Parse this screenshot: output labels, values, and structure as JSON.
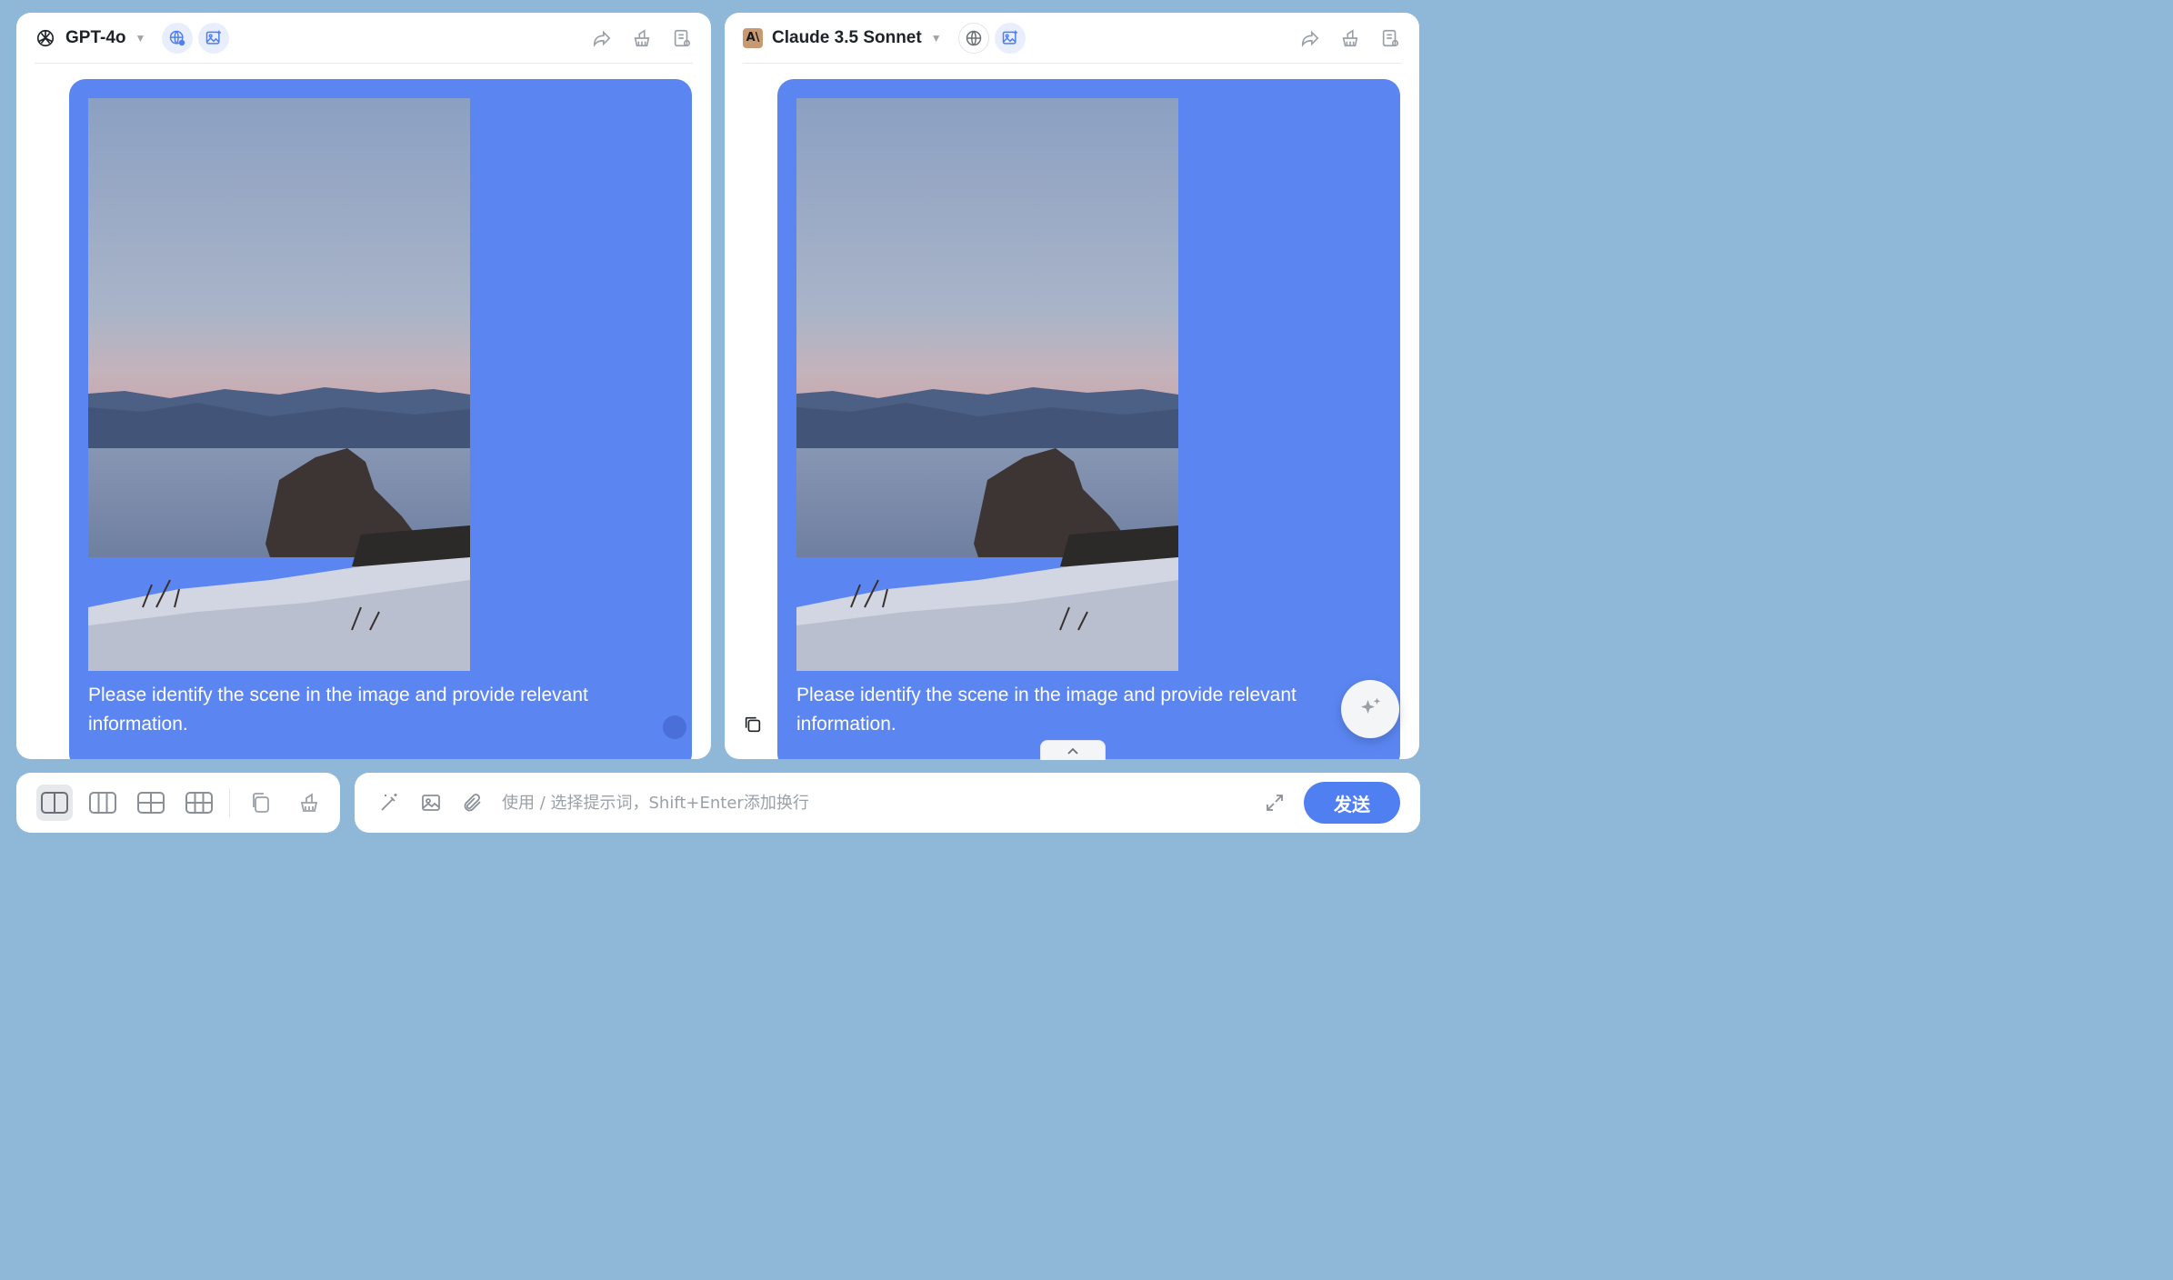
{
  "panels": [
    {
      "model_name": "GPT-4o",
      "model_logo": "openai-logo-icon",
      "web_search_active": true,
      "image_gen_active": true,
      "message": "Please identify the scene in the image and provide relevant information."
    },
    {
      "model_name": "Claude 3.5 Sonnet",
      "model_logo": "anthropic-logo-icon",
      "model_logo_text": "A\\",
      "web_search_active": false,
      "image_gen_active": true,
      "message": "Please identify the scene in the image and provide relevant information."
    }
  ],
  "input": {
    "placeholder": "使用 / 选择提示词，Shift+Enter添加换行",
    "send_label": "发送"
  },
  "layouts": [
    "single",
    "two-column",
    "grid-2x2",
    "grid-3x2"
  ],
  "colors": {
    "accent": "#5b86f2",
    "send": "#4f7ff0",
    "background": "#8fb8d8"
  }
}
